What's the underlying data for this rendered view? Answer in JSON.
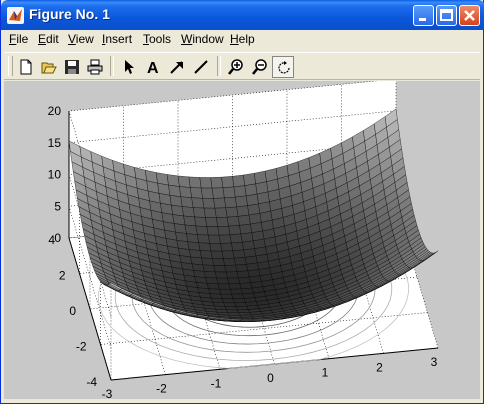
{
  "window": {
    "title": "Figure No. 1"
  },
  "title_buttons": [
    {
      "name": "minimize",
      "icon": "minimize-icon"
    },
    {
      "name": "maximize",
      "icon": "maximize-icon"
    },
    {
      "name": "close",
      "icon": "close-icon"
    }
  ],
  "menu": [
    {
      "label": "File",
      "mnemonic": "F"
    },
    {
      "label": "Edit",
      "mnemonic": "E"
    },
    {
      "label": "View",
      "mnemonic": "V"
    },
    {
      "label": "Insert",
      "mnemonic": "I"
    },
    {
      "label": "Tools",
      "mnemonic": "T"
    },
    {
      "label": "Window",
      "mnemonic": "W"
    },
    {
      "label": "Help",
      "mnemonic": "H"
    }
  ],
  "toolbar": [
    {
      "icon": "new-figure-icon"
    },
    {
      "icon": "open-file-icon"
    },
    {
      "icon": "save-icon"
    },
    {
      "icon": "print-icon"
    },
    {
      "icon": "select-arrow-icon"
    },
    {
      "icon": "insert-text-icon",
      "glyph": "A"
    },
    {
      "icon": "insert-arrow-icon"
    },
    {
      "icon": "insert-line-icon"
    },
    {
      "icon": "zoom-in-icon"
    },
    {
      "icon": "zoom-out-icon"
    },
    {
      "icon": "rotate-3d-icon",
      "pressed": true
    }
  ],
  "colors": {
    "title_bar": "#0a56d6",
    "window_bg": "#ece9d8",
    "figure_bg": "#c8c8c8",
    "axes_bg": "#ffffff"
  },
  "chart_data": {
    "type": "surface",
    "description_of_function": "paraboloid bowl with contour projection on floor",
    "x_ticks": [
      "-3",
      "-2",
      "-1",
      "0",
      "1",
      "2",
      "3"
    ],
    "y_ticks": [
      "-4",
      "-2",
      "0",
      "2",
      "4"
    ],
    "z_ticks": [
      "0",
      "5",
      "10",
      "15",
      "20"
    ],
    "xlim": [
      -3,
      3
    ],
    "ylim": [
      -4,
      4
    ],
    "zlim": [
      0,
      20
    ],
    "grid": true,
    "colormap": "gray"
  }
}
